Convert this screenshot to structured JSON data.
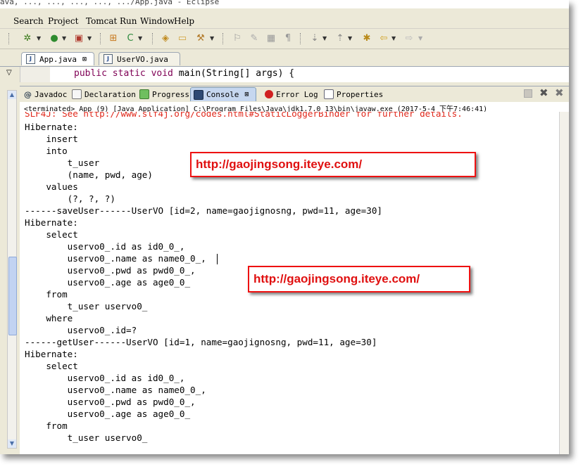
{
  "window": {
    "title_partial": "ava, ..., ..., ..., ..., .../App.java - Eclipse"
  },
  "menu": [
    "Search",
    "Project",
    "Tomcat",
    "Run",
    "Window",
    "Help"
  ],
  "editor": {
    "tabs": [
      {
        "label": "App.java",
        "close": "⊠"
      },
      {
        "label": "UserVO.java"
      }
    ],
    "code_line_kw": "public static void",
    "code_line_rest": " main(String[] args) {"
  },
  "views": {
    "tabs": [
      "Javadoc",
      "Declaration",
      "Progress",
      "Console",
      "Error Log",
      "Properties"
    ],
    "active": "Console",
    "close_mark": "⊠"
  },
  "console": {
    "status": "<terminated> App (9) [Java Application] C:\\Program Files\\Java\\jdk1.7.0_13\\bin\\javaw.exe (2017-5-4 下午7:46:41)",
    "top_partial": "SLF4J: See http://www.slf4j.org/codes.html#StaticLoggerBinder for further details.",
    "lines": [
      "Hibernate:",
      "    insert",
      "    into",
      "        t_user",
      "        (name, pwd, age)",
      "    values",
      "        (?, ?, ?)",
      "------saveUser------UserVO [id=2, name=gaojignosng, pwd=11, age=30]",
      "Hibernate:",
      "    select",
      "        uservo0_.id as id0_0_,",
      "        uservo0_.name as name0_0_,",
      "        uservo0_.pwd as pwd0_0_,",
      "        uservo0_.age as age0_0_",
      "    from",
      "        t_user uservo0_",
      "    where",
      "        uservo0_.id=?",
      "------getUser------UserVO [id=1, name=gaojignosng, pwd=11, age=30]",
      "Hibernate:",
      "    select",
      "        uservo0_.id as id0_0_,",
      "        uservo0_.name as name0_0_,",
      "        uservo0_.pwd as pwd0_0_,",
      "        uservo0_.age as age0_0_",
      "    from",
      "        t_user uservo0_"
    ]
  },
  "watermarks": [
    "http://gaojingsong.iteye.com/",
    "http://gaojingsong.iteye.com/"
  ],
  "colors": {
    "accent": "#e01010",
    "keyword": "#7f0055",
    "stderr": "#e0281b",
    "active_tab": "#c6d7ef"
  }
}
